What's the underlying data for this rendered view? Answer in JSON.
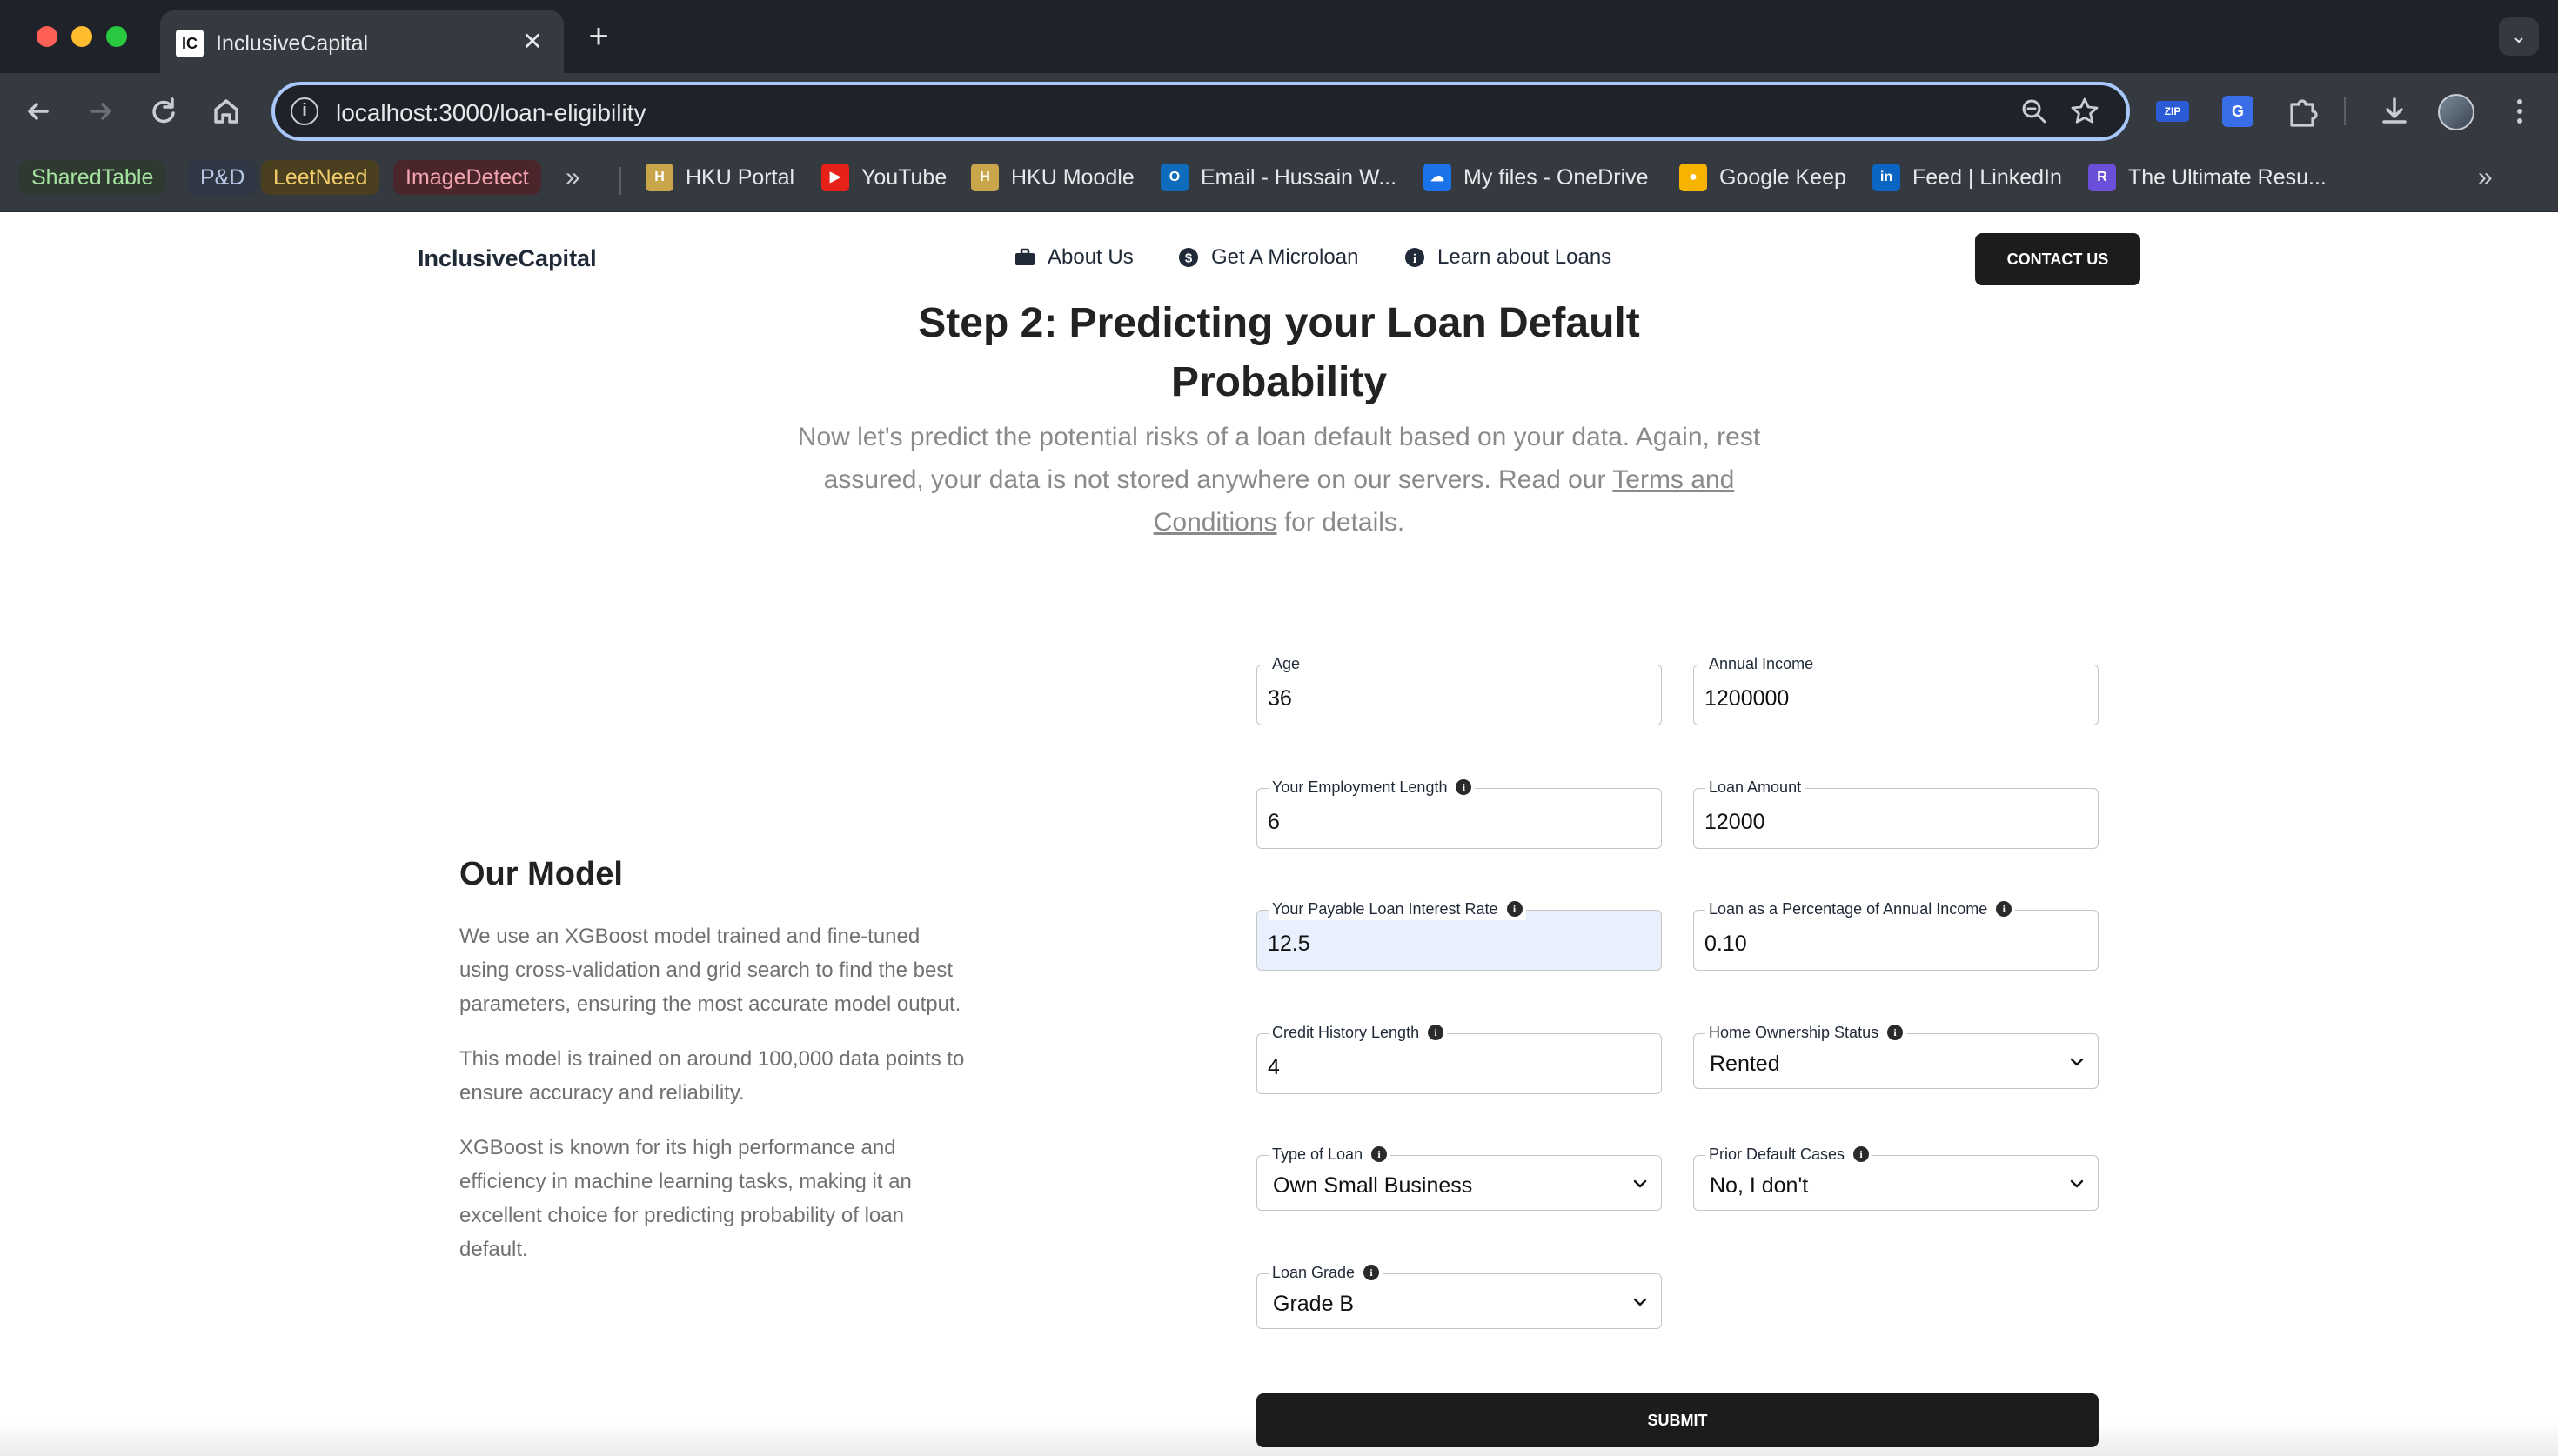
{
  "browser": {
    "tab_title": "InclusiveCapital",
    "tab_favicon": "IC",
    "url": "localhost:3000/loan-eligibility",
    "extensions": {
      "zip": "ZIP",
      "translate": "G"
    },
    "bookmarks_pills": [
      "SharedTable",
      "P&D",
      "LeetNeed",
      "ImageDetect"
    ],
    "bookmarks": [
      {
        "label": "HKU Portal",
        "icon": "hku-icon"
      },
      {
        "label": "YouTube",
        "icon": "youtube-icon"
      },
      {
        "label": "HKU Moodle",
        "icon": "hku-icon"
      },
      {
        "label": "Email - Hussain W...",
        "icon": "outlook-icon"
      },
      {
        "label": "My files - OneDrive",
        "icon": "onedrive-icon"
      },
      {
        "label": "Google Keep",
        "icon": "keep-icon"
      },
      {
        "label": "Feed | LinkedIn",
        "icon": "linkedin-icon"
      },
      {
        "label": "The Ultimate Resu...",
        "icon": "resume-icon"
      }
    ]
  },
  "nav": {
    "brand": "InclusiveCapital",
    "links": [
      "About Us",
      "Get A Microloan",
      "Learn about Loans"
    ],
    "contact": "CONTACT US"
  },
  "hero": {
    "title_line1": "Step 2: Predicting your Loan Default",
    "title_line2": "Probability",
    "subtitle_pre": "Now let's predict the potential risks of a loan default based on your data. Again, rest assured, your data is not stored anywhere on our servers. Read our ",
    "subtitle_link": "Terms and Conditions",
    "subtitle_post": " for details."
  },
  "model": {
    "title": "Our Model",
    "p1": "We use an XGBoost model trained and fine-tuned using cross-validation and grid search to find the best parameters, ensuring the most accurate model output.",
    "p2": "This model is trained on around 100,000 data points to ensure accuracy and reliability.",
    "p3": "XGBoost is known for its high performance and efficiency in machine learning tasks, making it an excellent choice for predicting probability of loan default."
  },
  "form": {
    "age": {
      "label": "Age",
      "value": "36"
    },
    "income": {
      "label": "Annual Income",
      "value": "1200000"
    },
    "employment": {
      "label": "Your Employment Length",
      "value": "6"
    },
    "loan_amount": {
      "label": "Loan Amount",
      "value": "12000"
    },
    "interest": {
      "label": "Your Payable Loan Interest Rate",
      "value": "12.5"
    },
    "loan_pct": {
      "label": "Loan as a Percentage of Annual Income",
      "value": "0.10"
    },
    "credit_history": {
      "label": "Credit History Length",
      "value": "4"
    },
    "home": {
      "label": "Home Ownership Status",
      "value": "Rented"
    },
    "loan_type": {
      "label": "Type of Loan",
      "value": "Own Small Business"
    },
    "prior_default": {
      "label": "Prior Default Cases",
      "value": "No, I don't"
    },
    "grade": {
      "label": "Loan Grade",
      "value": "Grade B"
    },
    "submit": "SUBMIT"
  }
}
